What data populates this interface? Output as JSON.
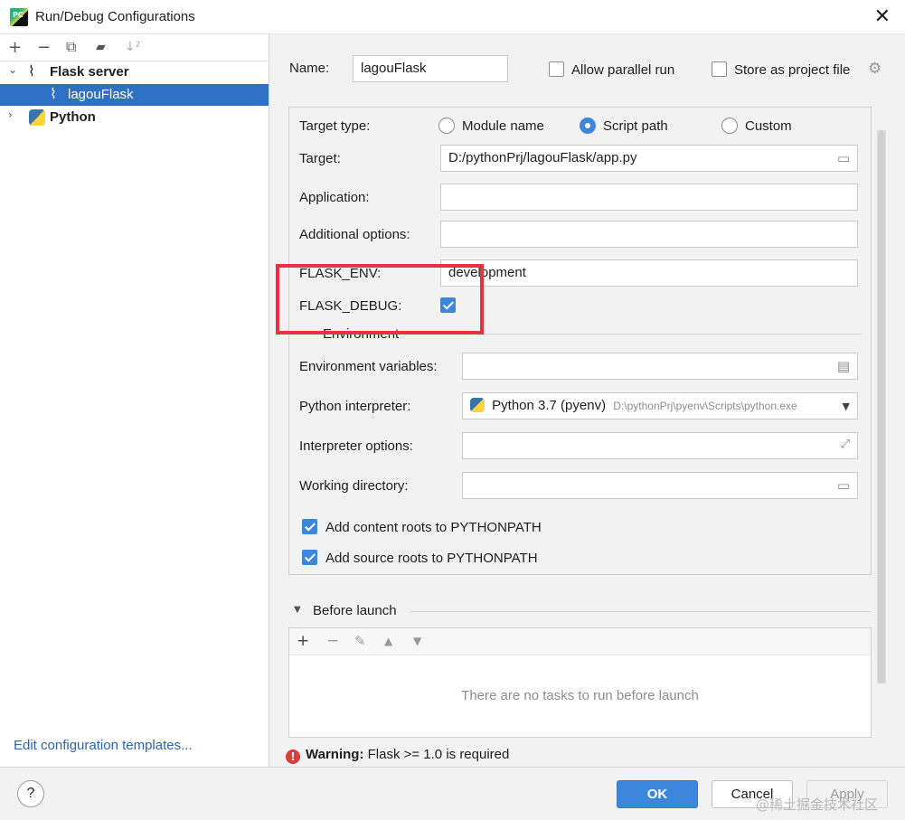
{
  "window": {
    "app_icon_text": "PC",
    "title": "Run/Debug Configurations",
    "close_glyph": "✕"
  },
  "left_toolbar": {
    "add": "+",
    "remove": "−",
    "copy": "⧉",
    "folder": "▰",
    "sort": "↓²"
  },
  "tree": {
    "flask_group": "Flask server",
    "flask_item": "lagouFlask",
    "python_group": "Python"
  },
  "edit_templates_link": "Edit configuration templates...",
  "name_row": {
    "label": "Name:",
    "value": "lagouFlask",
    "allow_parallel": "Allow parallel run",
    "store_project": "Store as project file"
  },
  "config": {
    "target_type_label": "Target type:",
    "radio_module": "Module name",
    "radio_script": "Script path",
    "radio_custom": "Custom",
    "target_label": "Target:",
    "target_value": "D:/pythonPrj/lagouFlask/app.py",
    "application_label": "Application:",
    "additional_label": "Additional options:",
    "flask_env_label": "FLASK_ENV:",
    "flask_env_value": "development",
    "flask_debug_label": "FLASK_DEBUG:",
    "environment_section": "Environment",
    "env_vars_label": "Environment variables:",
    "interpreter_label": "Python interpreter:",
    "interpreter_name": "Python 3.7 (pyenv)",
    "interpreter_path": "D:\\pythonPrj\\pyenv\\Scripts\\python.exe",
    "interp_options_label": "Interpreter options:",
    "working_dir_label": "Working directory:",
    "content_roots": "Add content roots to PYTHONPATH",
    "source_roots": "Add source roots to PYTHONPATH"
  },
  "before_launch": {
    "title": "Before launch",
    "empty": "There are no tasks to run before launch"
  },
  "warning": {
    "strong": "Warning:",
    "text": " Flask >= 1.0 is required"
  },
  "buttons": {
    "help": "?",
    "ok": "OK",
    "cancel": "Cancel",
    "apply": "Apply"
  },
  "watermark": "@稀土掘金技术社区",
  "colors": {
    "accent": "#3d86dd",
    "selection": "#2f6fc4",
    "highlight_box": "#e8323c",
    "link": "#2a64b5"
  }
}
